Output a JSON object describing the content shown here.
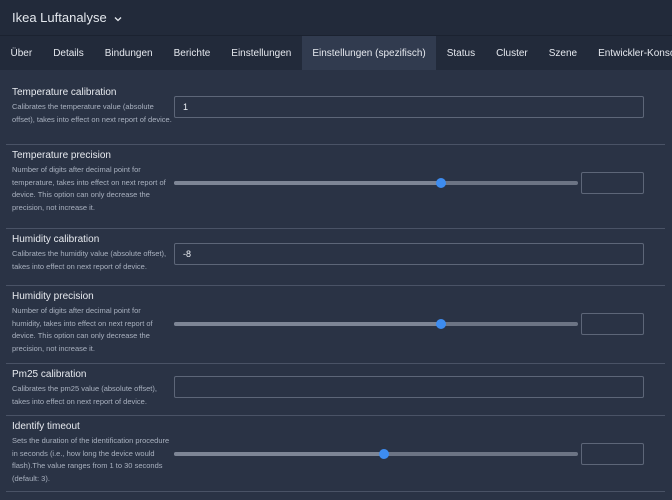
{
  "header": {
    "device_name": "Ikea Luftanalyse"
  },
  "tabs": [
    {
      "label": "Über"
    },
    {
      "label": "Details"
    },
    {
      "label": "Bindungen"
    },
    {
      "label": "Berichte"
    },
    {
      "label": "Einstellungen"
    },
    {
      "label": "Einstellungen (spezifisch)",
      "active": true
    },
    {
      "label": "Status"
    },
    {
      "label": "Cluster"
    },
    {
      "label": "Szene"
    },
    {
      "label": "Entwickler-Konsole"
    }
  ],
  "settings": [
    {
      "label": "Temperature calibration",
      "description": "Calibrates the temperature value (absolute offset), takes into effect on next report of device.",
      "type": "text",
      "value": "1"
    },
    {
      "label": "Temperature precision",
      "description": "Number of digits after decimal point for temperature, takes into effect on next report of device. This option can only decrease the precision, not increase it.",
      "type": "slider",
      "level_fraction": 0.66,
      "value": ""
    },
    {
      "label": "Humidity calibration",
      "description": "Calibrates the humidity value (absolute offset), takes into effect on next report of device.",
      "type": "text",
      "value": "-8"
    },
    {
      "label": "Humidity precision",
      "description": "Number of digits after decimal point for humidity, takes into effect on next report of device. This option can only decrease the precision, not increase it.",
      "type": "slider",
      "level_fraction": 0.66,
      "value": ""
    },
    {
      "label": "Pm25 calibration",
      "description": "Calibrates the pm25 value (absolute offset), takes into effect on next report of device.",
      "type": "text",
      "value": ""
    },
    {
      "label": "Identify timeout",
      "description": "Sets the duration of the identification procedure in seconds (i.e., how long the device would flash).The value ranges from 1 to 30 seconds (default: 3).",
      "type": "slider",
      "level_fraction": 0.52,
      "value": ""
    }
  ],
  "colors": {
    "accent": "#3d8cf0",
    "background": "#2a3345",
    "bar": "#222a3a"
  }
}
